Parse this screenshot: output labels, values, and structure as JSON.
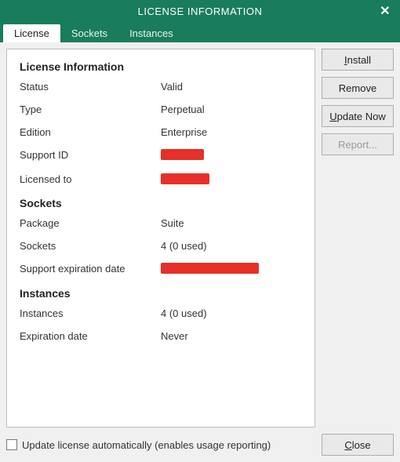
{
  "window": {
    "title": "LICENSE INFORMATION"
  },
  "tabs": {
    "license": "License",
    "sockets": "Sockets",
    "instances": "Instances"
  },
  "headings": {
    "license_info": "License Information",
    "sockets": "Sockets",
    "instances": "Instances"
  },
  "fields": {
    "status": {
      "label": "Status",
      "value": "Valid"
    },
    "type": {
      "label": "Type",
      "value": "Perpetual"
    },
    "edition": {
      "label": "Edition",
      "value": "Enterprise"
    },
    "support_id": {
      "label": "Support ID",
      "value": ""
    },
    "licensed_to": {
      "label": "Licensed to",
      "value": ""
    },
    "package": {
      "label": "Package",
      "value": "Suite"
    },
    "sockets": {
      "label": "Sockets",
      "value": "4 (0 used)"
    },
    "support_expiration": {
      "label": "Support expiration date",
      "value": ""
    },
    "instances": {
      "label": "Instances",
      "value": "4 (0 used)"
    },
    "expiration": {
      "label": "Expiration date",
      "value": "Never"
    }
  },
  "buttons": {
    "install_pre": "",
    "install_mn": "I",
    "install_post": "nstall",
    "remove": "Remove",
    "update_pre": "",
    "update_mn": "U",
    "update_post": "pdate Now",
    "report": "Report...",
    "close_pre": "",
    "close_mn": "C",
    "close_post": "lose"
  },
  "footer": {
    "checkbox_label": "Update license automatically (enables usage reporting)"
  }
}
